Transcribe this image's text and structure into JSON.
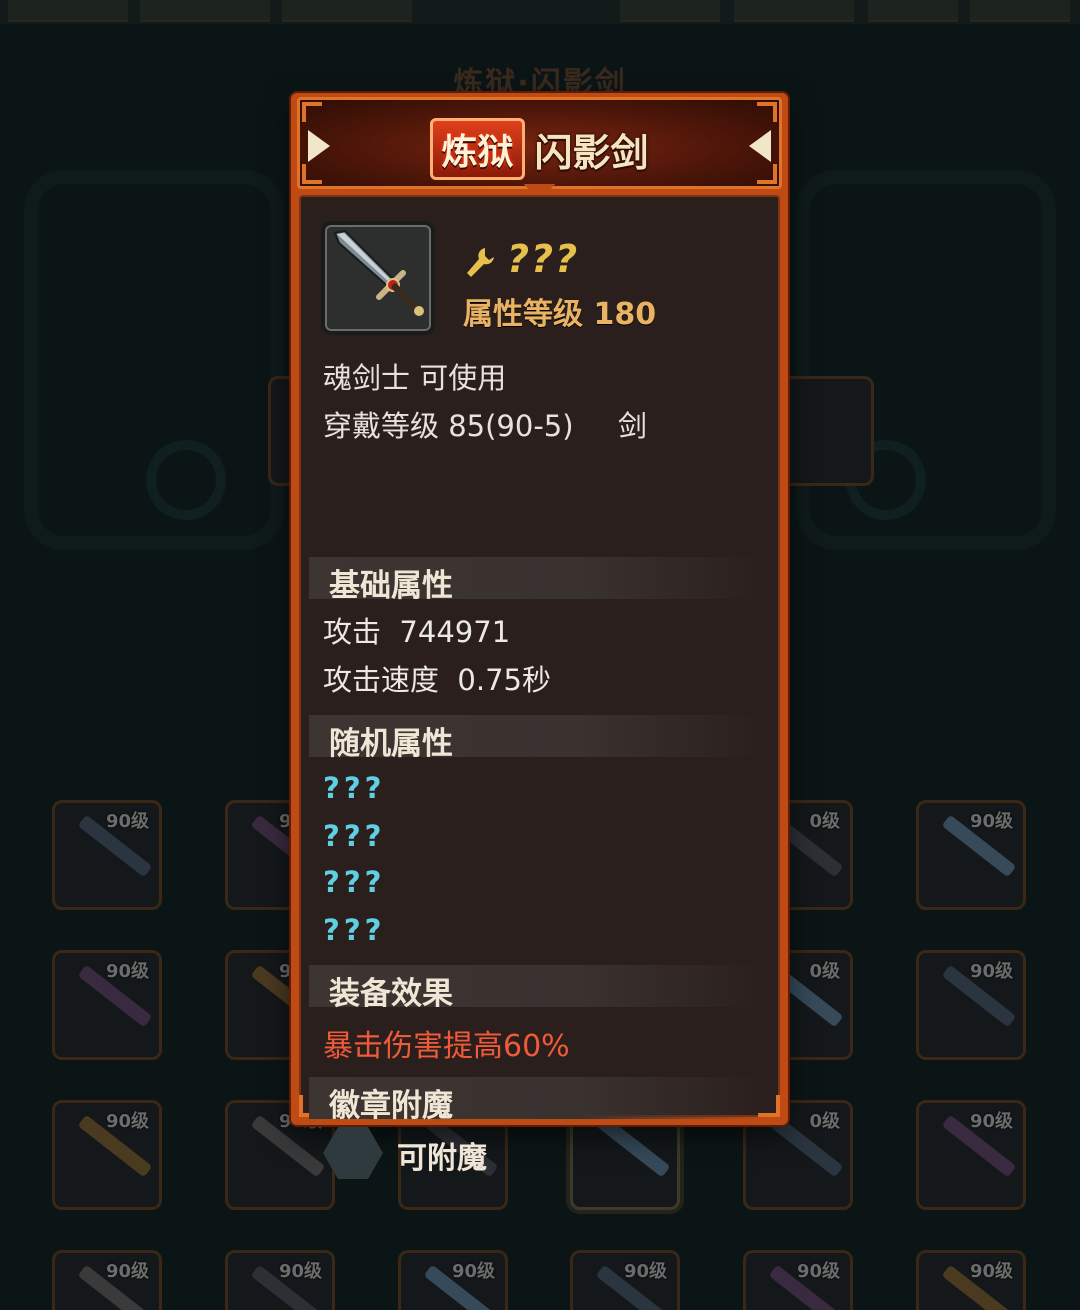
{
  "background": {
    "title": "炼狱·闪影剑",
    "slot_level_label": "90级",
    "slot_rows": [
      [
        "90级",
        "90级",
        "",
        "",
        "0级",
        "90级"
      ],
      [
        "90级",
        "90级",
        "",
        "",
        "0级",
        "90级"
      ],
      [
        "90级",
        "90级",
        "",
        "",
        "0级",
        "90级"
      ],
      [
        "90级",
        "90级",
        "90级",
        "90级",
        "90级",
        "90级"
      ]
    ]
  },
  "tooltip": {
    "grade_badge": "炼狱",
    "item_name": "闪影剑",
    "icon": "sword-icon",
    "enchant_icon": "wrench-icon",
    "enchant_text": "???",
    "attribute_level": "属性等级 180",
    "usable_class": "魂剑士 可使用",
    "wear_level": "穿戴等级 85(90-5)",
    "weapon_type": "剑",
    "base_section_title": "基础属性",
    "base_stats": [
      "攻击  744971",
      "攻击速度  0.75秒"
    ],
    "random_section_title": "随机属性",
    "random_stats": [
      "???",
      "???",
      "???",
      "???"
    ],
    "effect_section_title": "装备效果",
    "effect_text": "暴击伤害提高60%",
    "emblem_section_title": "徽章附魔",
    "emblem_slot_label": "可附魔"
  },
  "colors": {
    "panel_border": "#c04a14",
    "body_bg": "#2a1f1d",
    "accent_gold": "#e9b363",
    "random_cyan": "#5fd0e4",
    "effect_red": "#ef5a38"
  }
}
